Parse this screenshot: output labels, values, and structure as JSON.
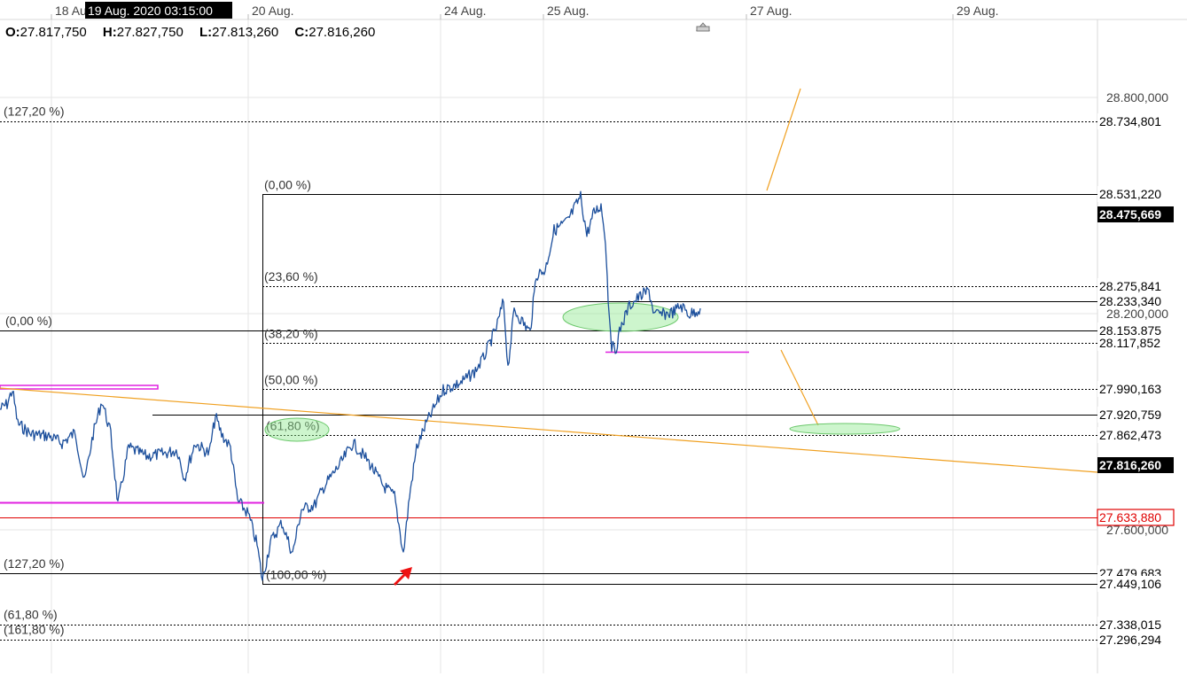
{
  "crosshair_time": "19 Aug. 2020 03:15:00",
  "ohlc": {
    "open_label": "O:",
    "open": "27.817,750",
    "high_label": "H:",
    "high": "27.827,750",
    "low_label": "L:",
    "low": "27.813,260",
    "close_label": "C:",
    "close": "27.816,260"
  },
  "chart_data": {
    "type": "line",
    "x_tick_labels": [
      "18 Aug.",
      "20 Aug.",
      "24 Aug.",
      "25 Aug.",
      "27 Aug.",
      "29 Aug."
    ],
    "y_tick_labels": [
      "28.800,000",
      "28.200,000",
      "27.600,000"
    ],
    "ylim": [
      27.2,
      28.96
    ],
    "grid": true,
    "current_price": "27.816,260",
    "last_price_tag": "28.475,669",
    "series": [
      {
        "x": [
          "18 Aug.",
          "19 Aug.",
          "19 Aug.",
          "20 Aug.",
          "20 Aug.",
          "21 Aug.",
          "21 Aug.",
          "24 Aug.",
          "24 Aug.",
          "25 Aug.",
          "25 Aug.",
          "26 Aug.",
          "26 Aug.",
          "26 Aug."
        ],
        "y": [
          27.87,
          27.72,
          27.87,
          27.78,
          27.47,
          27.59,
          27.77,
          27.58,
          27.85,
          28.02,
          28.3,
          28.52,
          28.12,
          28.22
        ]
      }
    ],
    "horizontal_levels": [
      {
        "label": "28.734,801",
        "value": 28.734801,
        "style": "dotted",
        "color": "#000000"
      },
      {
        "label": "28.531,220",
        "value": 28.53122,
        "style": "solid",
        "color": "#000000"
      },
      {
        "label": "28.275,841",
        "value": 28.275841,
        "style": "dotted",
        "color": "#000000"
      },
      {
        "label": "28.233,340",
        "value": 28.23334,
        "style": "solid",
        "color": "#000000"
      },
      {
        "label": "28.153,875",
        "value": 28.153875,
        "style": "solid",
        "color": "#000000"
      },
      {
        "label": "28.117,852",
        "value": 28.117852,
        "style": "dotted",
        "color": "#000000"
      },
      {
        "label": "27.990,163",
        "value": 27.990163,
        "style": "dotted",
        "color": "#000000"
      },
      {
        "label": "27.920,759",
        "value": 27.920759,
        "style": "solid",
        "color": "#000000"
      },
      {
        "label": "27.862,473",
        "value": 27.862473,
        "style": "dotted",
        "color": "#000000"
      },
      {
        "label": "27.633,880",
        "value": 27.63388,
        "style": "solid",
        "color": "#e00000"
      },
      {
        "label": "27.479,683",
        "value": 27.479683,
        "style": "solid",
        "color": "#000000"
      },
      {
        "label": "27.449,106",
        "value": 27.449106,
        "style": "solid",
        "color": "#000000"
      },
      {
        "label": "27.338,015",
        "value": 27.338015,
        "style": "dotted",
        "color": "#000000"
      },
      {
        "label": "27.296,294",
        "value": 27.296294,
        "style": "dotted",
        "color": "#000000"
      }
    ],
    "fib_labels": [
      {
        "text": "(127,20 %)",
        "value": 28.734801
      },
      {
        "text": "(0,00 %)",
        "value": 28.53122
      },
      {
        "text": "(23,60 %)",
        "value": 28.275841
      },
      {
        "text": "(0,00 %)",
        "value": 28.153875
      },
      {
        "text": "(38,20 %)",
        "value": 28.117852
      },
      {
        "text": "(50,00 %)",
        "value": 27.990163
      },
      {
        "text": "(61,80 %)",
        "value": 27.862473
      },
      {
        "text": "(127,20 %)",
        "value": 27.479683
      },
      {
        "text": "(100,00 %)",
        "value": 27.449106
      },
      {
        "text": "(61,80 %)",
        "value": 27.338015
      },
      {
        "text": "(161,80 %)",
        "value": 27.296294
      }
    ],
    "colors": {
      "price": "#1c4f9c",
      "trendline": "#f0a020",
      "support_magenta": "#e020e0",
      "highlight_green": "#90e890",
      "stop_level": "#e00000",
      "arrow": "#ee1111",
      "tag_bg": "#000000",
      "tag_text": "#ffffff"
    }
  }
}
